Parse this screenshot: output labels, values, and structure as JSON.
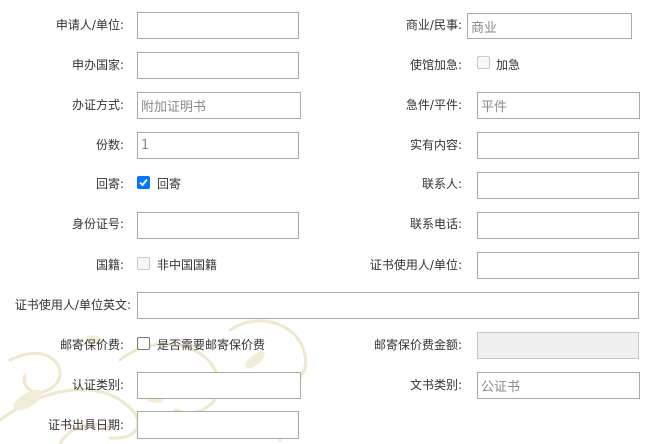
{
  "form": {
    "applicant": {
      "label": "申请人/单位:",
      "value": ""
    },
    "business_type": {
      "label": "商业/民事:",
      "value": "商业"
    },
    "country": {
      "label": "申办国家:",
      "value": ""
    },
    "embassy_urgent": {
      "label": "使馆加急:",
      "checkbox_label": "加急",
      "checked": false,
      "disabled": true
    },
    "certify_method": {
      "label": "办证方式:",
      "value": "附加证明书"
    },
    "urgency": {
      "label": "急件/平件:",
      "value": "平件"
    },
    "copies": {
      "label": "份数:",
      "value": "1"
    },
    "actual_content": {
      "label": "实有内容:",
      "value": ""
    },
    "return_mail": {
      "label": "回寄:",
      "checkbox_label": "回寄",
      "checked": true
    },
    "contact": {
      "label": "联系人:",
      "value": ""
    },
    "id_number": {
      "label": "身份证号:",
      "value": ""
    },
    "phone": {
      "label": "联系电话:",
      "value": ""
    },
    "nationality": {
      "label": "国籍:",
      "checkbox_label": "非中国国籍",
      "checked": false,
      "disabled": true
    },
    "cert_user": {
      "label": "证书使用人/单位:",
      "value": ""
    },
    "cert_user_en": {
      "label": "证书使用人/单位英文:",
      "value": ""
    },
    "insurance": {
      "label": "邮寄保价费:",
      "checkbox_label": "是否需要邮寄保价费",
      "checked": false
    },
    "insurance_amount": {
      "label": "邮寄保价费金额:",
      "value": ""
    },
    "cert_category": {
      "label": "认证类别:",
      "value": ""
    },
    "doc_type": {
      "label": "文书类别:",
      "value": "公证书"
    },
    "issue_date": {
      "label": "证书出具日期:",
      "value": ""
    }
  },
  "colors": {
    "checkbox_accent": "#0075ff",
    "input_border": "#a9a9a9",
    "disabled_bg": "#f0f0f0",
    "decoration": "#efe9d2"
  }
}
